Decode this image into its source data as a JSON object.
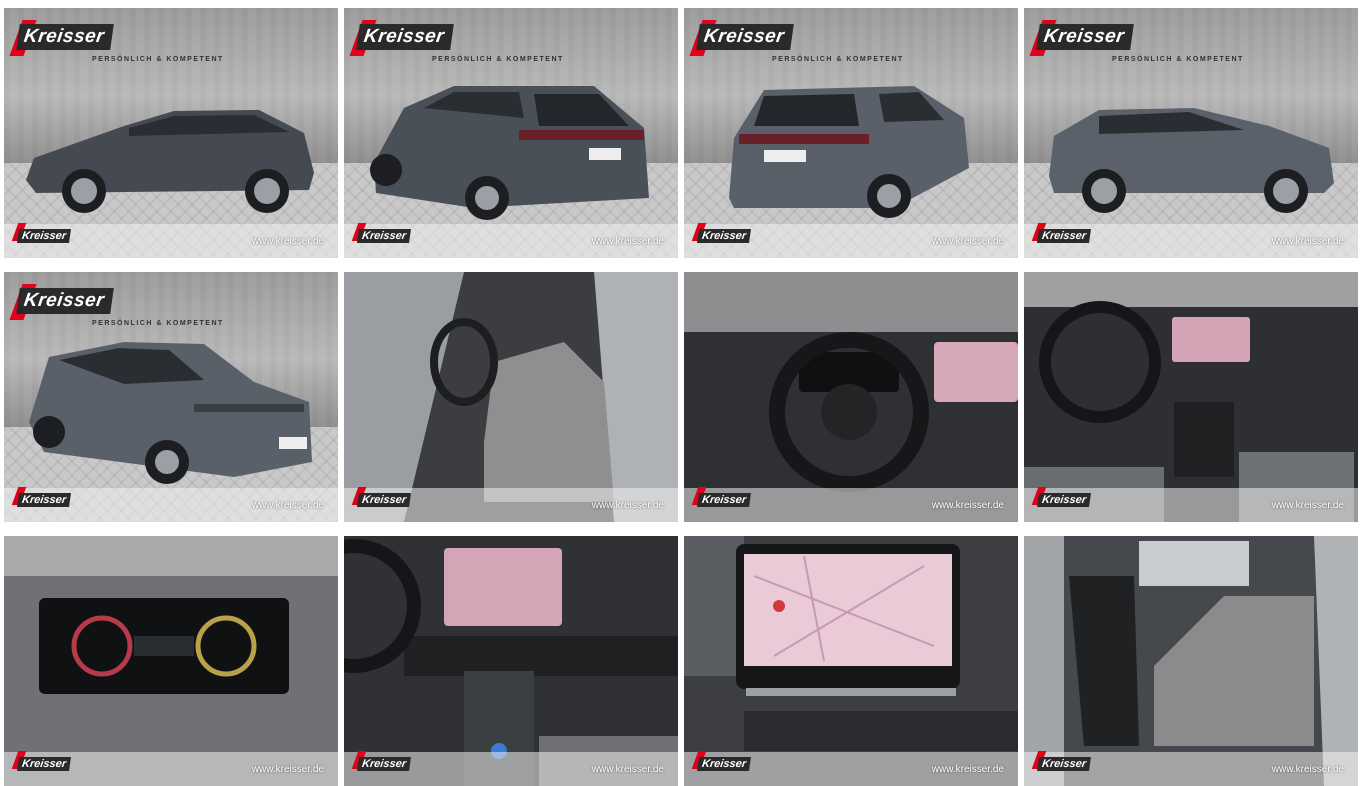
{
  "brand": {
    "name": "Kreisser",
    "tagline": "PERSÖNLICH & KOMPETENT",
    "website": "www.kreisser.de",
    "accent_color": "#e3001b",
    "car_color": "#4a5058"
  },
  "gallery": {
    "photos": [
      {
        "subject": "car-side-left",
        "style": "exterior",
        "logo_top": true
      },
      {
        "subject": "car-rear-left",
        "style": "exterior",
        "logo_top": true
      },
      {
        "subject": "car-rear-right",
        "style": "exterior",
        "logo_top": true
      },
      {
        "subject": "car-side-right",
        "style": "exterior",
        "logo_top": true
      },
      {
        "subject": "car-front-left",
        "style": "exterior",
        "logo_top": true
      },
      {
        "subject": "interior-front-seats",
        "style": "interior",
        "logo_top": false
      },
      {
        "subject": "interior-steering-wheel",
        "style": "interior",
        "logo_top": false
      },
      {
        "subject": "interior-dashboard",
        "style": "interior",
        "logo_top": false
      },
      {
        "subject": "digital-cockpit",
        "style": "interior",
        "logo_top": false
      },
      {
        "subject": "center-console",
        "style": "interior",
        "logo_top": false
      },
      {
        "subject": "infotainment-map",
        "style": "interior",
        "logo_top": false
      },
      {
        "subject": "rear-seats",
        "style": "interior",
        "logo_top": false
      }
    ]
  }
}
